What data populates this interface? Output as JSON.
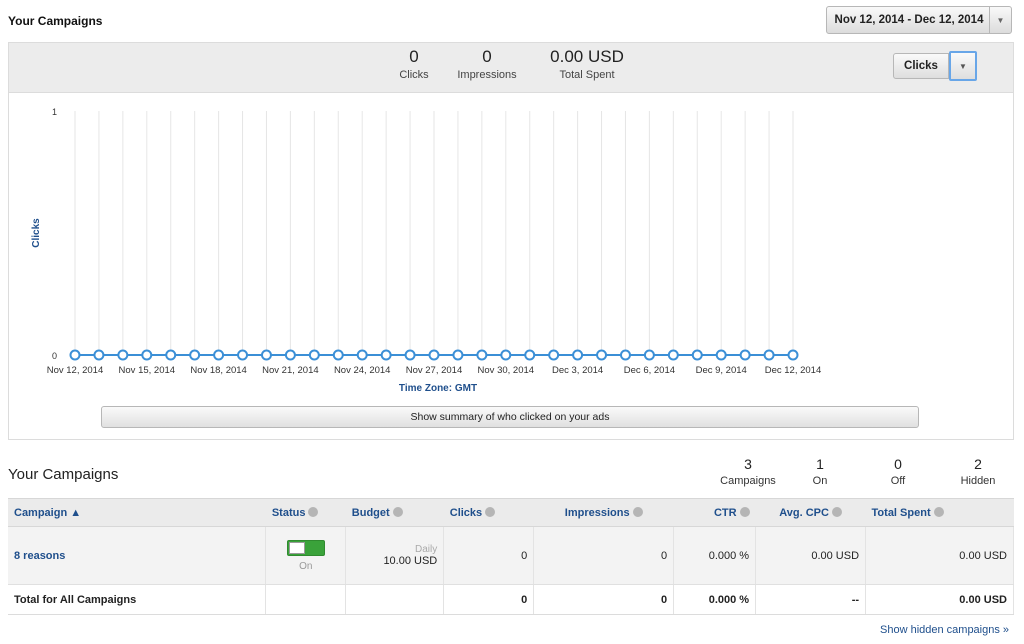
{
  "header": {
    "title": "Your Campaigns",
    "date_range": "Nov 12, 2014 - Dec 12, 2014"
  },
  "summary": {
    "clicks_value": "0",
    "clicks_label": "Clicks",
    "impressions_value": "0",
    "impressions_label": "Impressions",
    "spent_value": "0.00 USD",
    "spent_label": "Total Spent",
    "metric_select": "Clicks"
  },
  "chart_data": {
    "type": "line",
    "ylabel": "Clicks",
    "xlabel": "Time Zone: GMT",
    "ylim": [
      0,
      1
    ],
    "yticks": [
      "0",
      "1"
    ],
    "xtick_labels": [
      "Nov 12, 2014",
      "Nov 15, 2014",
      "Nov 18, 2014",
      "Nov 21, 2014",
      "Nov 24, 2014",
      "Nov 27, 2014",
      "Nov 30, 2014",
      "Dec 3, 2014",
      "Dec 6, 2014",
      "Dec 9, 2014",
      "Dec 12, 2014"
    ],
    "x": [
      "2014-11-12",
      "2014-11-13",
      "2014-11-14",
      "2014-11-15",
      "2014-11-16",
      "2014-11-17",
      "2014-11-18",
      "2014-11-19",
      "2014-11-20",
      "2014-11-21",
      "2014-11-22",
      "2014-11-23",
      "2014-11-24",
      "2014-11-25",
      "2014-11-26",
      "2014-11-27",
      "2014-11-28",
      "2014-11-29",
      "2014-11-30",
      "2014-12-01",
      "2014-12-02",
      "2014-12-03",
      "2014-12-04",
      "2014-12-05",
      "2014-12-06",
      "2014-12-07",
      "2014-12-08",
      "2014-12-09",
      "2014-12-10",
      "2014-12-11",
      "2014-12-12"
    ],
    "series": [
      {
        "values": [
          0,
          0,
          0,
          0,
          0,
          0,
          0,
          0,
          0,
          0,
          0,
          0,
          0,
          0,
          0,
          0,
          0,
          0,
          0,
          0,
          0,
          0,
          0,
          0,
          0,
          0,
          0,
          0,
          0,
          0,
          0
        ]
      }
    ],
    "grid": true,
    "line_color": "#3b8fd6"
  },
  "show_summary_label": "Show summary of who clicked on your ads",
  "campaigns": {
    "title": "Your Campaigns",
    "stats": [
      {
        "value": "3",
        "label": "Campaigns"
      },
      {
        "value": "1",
        "label": "On"
      },
      {
        "value": "0",
        "label": "Off"
      },
      {
        "value": "2",
        "label": "Hidden"
      }
    ],
    "columns": {
      "campaign": "Campaign ▲",
      "status": "Status",
      "budget": "Budget",
      "clicks": "Clicks",
      "impressions": "Impressions",
      "ctr": "CTR",
      "avg_cpc": "Avg. CPC",
      "total_spent": "Total Spent"
    },
    "rows": [
      {
        "name": "8 reasons",
        "status": "On",
        "budget_type": "Daily",
        "budget": "10.00 USD",
        "clicks": "0",
        "impressions": "0",
        "ctr": "0.000 %",
        "avg_cpc": "0.00 USD",
        "total_spent": "0.00 USD"
      }
    ],
    "total": {
      "label": "Total for All Campaigns",
      "clicks": "0",
      "impressions": "0",
      "ctr": "0.000 %",
      "avg_cpc": "--",
      "total_spent": "0.00 USD"
    },
    "hidden_link": "Show hidden campaigns »"
  },
  "colors": {
    "accent_blue": "#1f4f8c",
    "toggle_on": "#3aa23a",
    "chart_line": "#3b8fd6"
  }
}
